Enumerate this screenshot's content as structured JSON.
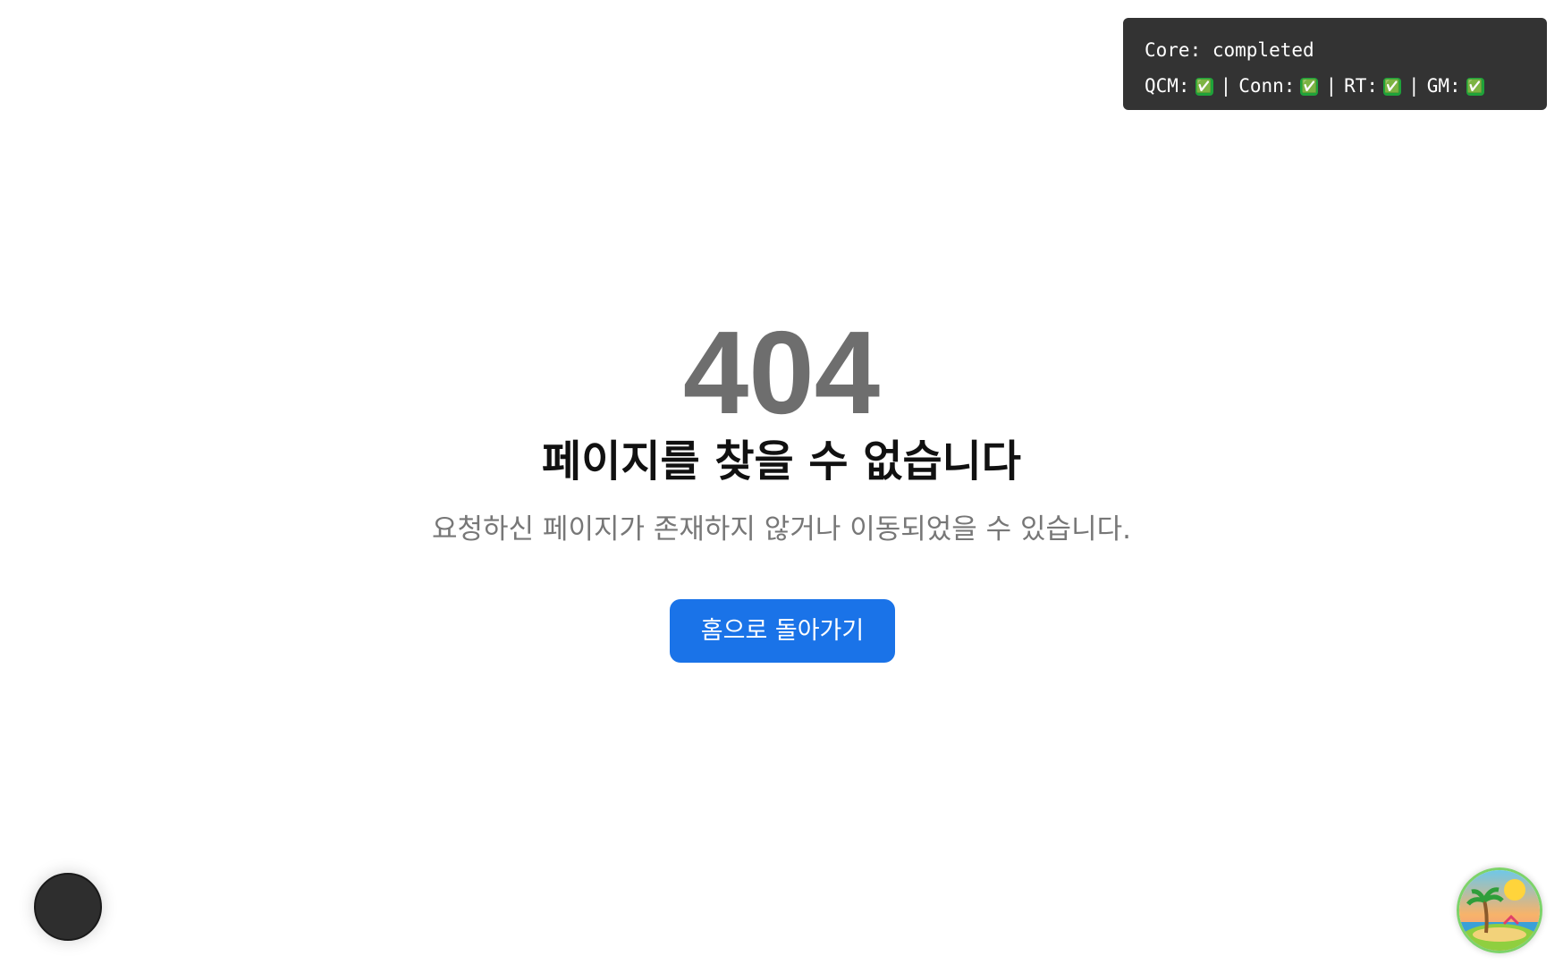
{
  "status_panel": {
    "core_label": "Core: completed",
    "items": [
      {
        "label": "QCM:",
        "status": "✅"
      },
      {
        "label": "Conn:",
        "status": "✅"
      },
      {
        "label": "RT:",
        "status": "✅"
      },
      {
        "label": "GM:",
        "status": "✅"
      }
    ],
    "separator": "|"
  },
  "error": {
    "code": "404",
    "title": "페이지를 찾을 수 없습니다",
    "description": "요청하신 페이지가 존재하지 않거나 이동되었을 수 있습니다."
  },
  "actions": {
    "home_label": "홈으로 돌아가기"
  },
  "widgets": {
    "left_fab_icon": "dark-circle-button",
    "right_avatar_icon": "island-avatar-icon"
  },
  "colors": {
    "primary": "#1a73e8",
    "code_gray": "#6e6e6e",
    "panel_bg": "#333333",
    "check_green": "#1fa23a"
  }
}
